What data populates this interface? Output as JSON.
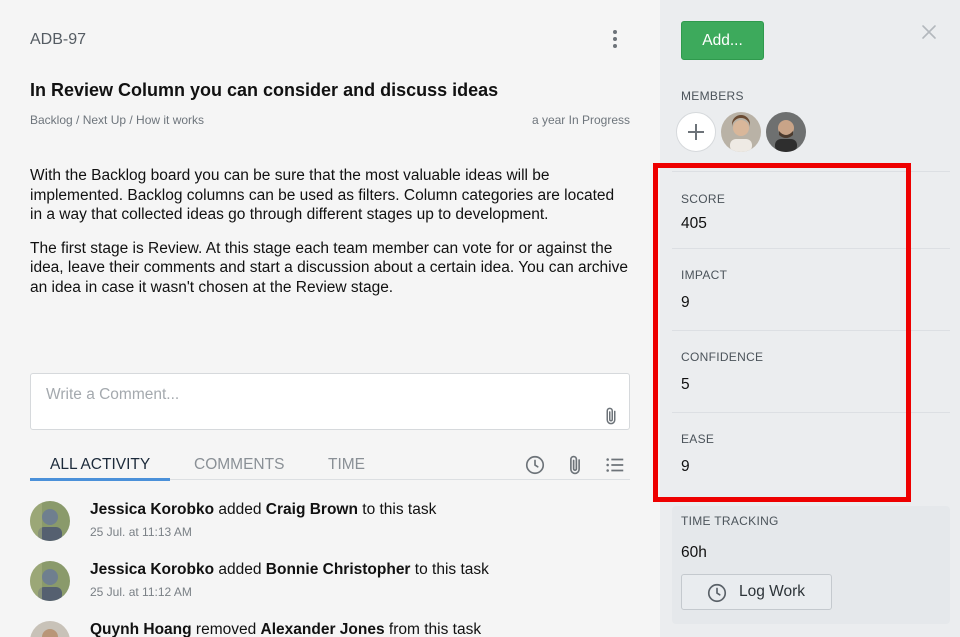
{
  "task": {
    "id": "ADB-97",
    "title": "In Review Column you can consider and discuss ideas",
    "breadcrumb": "Backlog / Next Up / How it works",
    "status": "a year In Progress",
    "description": [
      "With the Backlog board you can be sure that the most valuable ideas will be implemented. Backlog columns can be used as filters. Column categories are located in a way that collected ideas go through different stages up to development.",
      "The first stage is Review. At this stage each team member can vote for or against the idea, leave their comments and start a discussion about a certain idea. You can archive an idea in case it wasn't chosen at the Review stage."
    ]
  },
  "comment": {
    "placeholder": "Write a Comment..."
  },
  "tabs": [
    {
      "label": "ALL ACTIVITY",
      "active": true
    },
    {
      "label": "COMMENTS",
      "active": false
    },
    {
      "label": "TIME",
      "active": false
    }
  ],
  "activity": [
    {
      "actor": "Jessica Korobko",
      "action": "added",
      "target": "Craig Brown",
      "suffix": "to this task",
      "time": "25 Jul. at 11:13 AM"
    },
    {
      "actor": "Jessica Korobko",
      "action": "added",
      "target": "Bonnie Christopher",
      "suffix": "to this task",
      "time": "25 Jul. at 11:12 AM"
    },
    {
      "actor": "Quynh Hoang",
      "action": "removed",
      "target": "Alexander Jones",
      "suffix": "from this task",
      "time": ""
    }
  ],
  "sidebar": {
    "add_button": "Add...",
    "members_label": "MEMBERS",
    "score": {
      "label": "SCORE",
      "value": "405"
    },
    "impact": {
      "label": "IMPACT",
      "value": "9"
    },
    "confidence": {
      "label": "CONFIDENCE",
      "value": "5"
    },
    "ease": {
      "label": "EASE",
      "value": "9"
    },
    "time_tracking": {
      "label": "TIME TRACKING",
      "value": "60h",
      "button": "Log Work"
    }
  },
  "colors": {
    "accent_green": "#3daa5c",
    "tab_active": "#4a90d9",
    "highlight": "#ee0000"
  },
  "icons": [
    "kebab-menu-icon",
    "paperclip-icon",
    "clock-icon",
    "list-icon",
    "close-icon",
    "plus-icon"
  ]
}
